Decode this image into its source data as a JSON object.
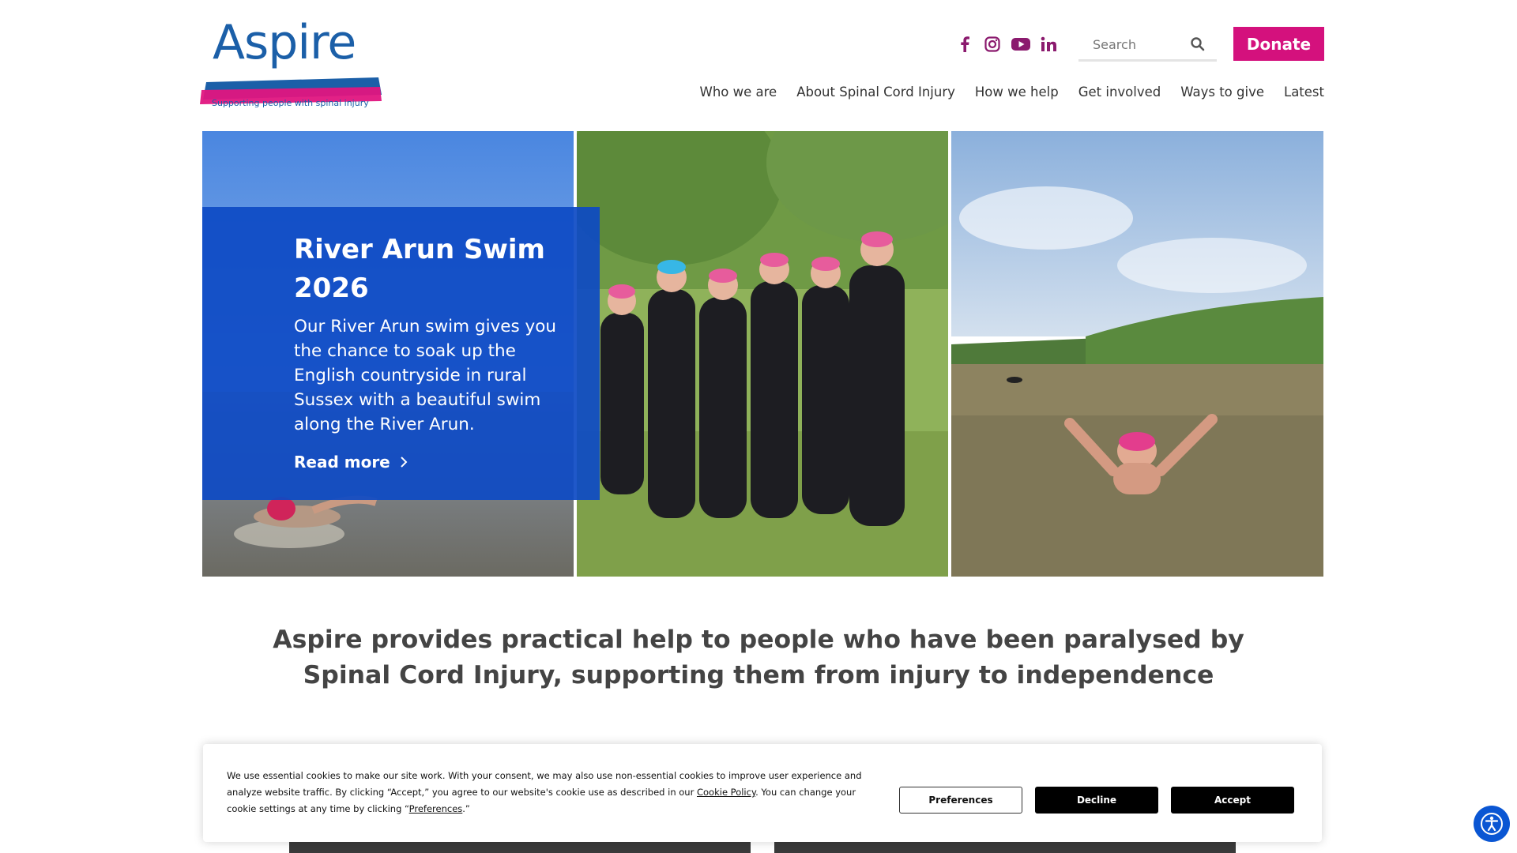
{
  "header": {
    "logo": {
      "wordmark": "Aspire",
      "tagline": "Supporting people with spinal injury"
    },
    "social": [
      {
        "icon": "facebook-icon"
      },
      {
        "icon": "instagram-icon"
      },
      {
        "icon": "youtube-icon"
      },
      {
        "icon": "linkedin-icon"
      }
    ],
    "search": {
      "placeholder": "Search",
      "icon": "search-icon"
    },
    "donate_label": "Donate",
    "nav": [
      "Who we are",
      "About Spinal Cord Injury",
      "How we help",
      "Get involved",
      "Ways to give",
      "Latest"
    ]
  },
  "hero": {
    "title": "River Arun Swim 2026",
    "description": "Our River Arun swim gives you the chance to soak up the English countryside in rural Sussex with a beautiful swim along the River Arun.",
    "cta": "Read more",
    "cta_icon": "chevron-right-icon"
  },
  "tagline": "Aspire provides practical help to people who have been paralysed by Spinal Cord Injury, supporting them from injury to independence",
  "cookie_banner": {
    "text_before_link": "We use essential cookies to make our site work. With your consent, we may also use non-essential cookies to improve user experience and analyze website traffic. By clicking “Accept,” you agree to our website's cookie use as described in our ",
    "policy_link": "Cookie Policy",
    "text_after_link": ". You can change your cookie settings at any time by clicking “",
    "preferences_link": "Preferences",
    "text_end": ".”",
    "buttons": {
      "preferences": "Preferences",
      "decline": "Decline",
      "accept": "Accept"
    }
  },
  "colors": {
    "brand_blue": "#1b5fa8",
    "brand_pink": "#d4117d",
    "social_icon": "#8b1a6e",
    "hero_card": "#0d4ac4",
    "accessibility_button": "#0a56d3"
  },
  "accessibility_icon": "accessibility-icon"
}
